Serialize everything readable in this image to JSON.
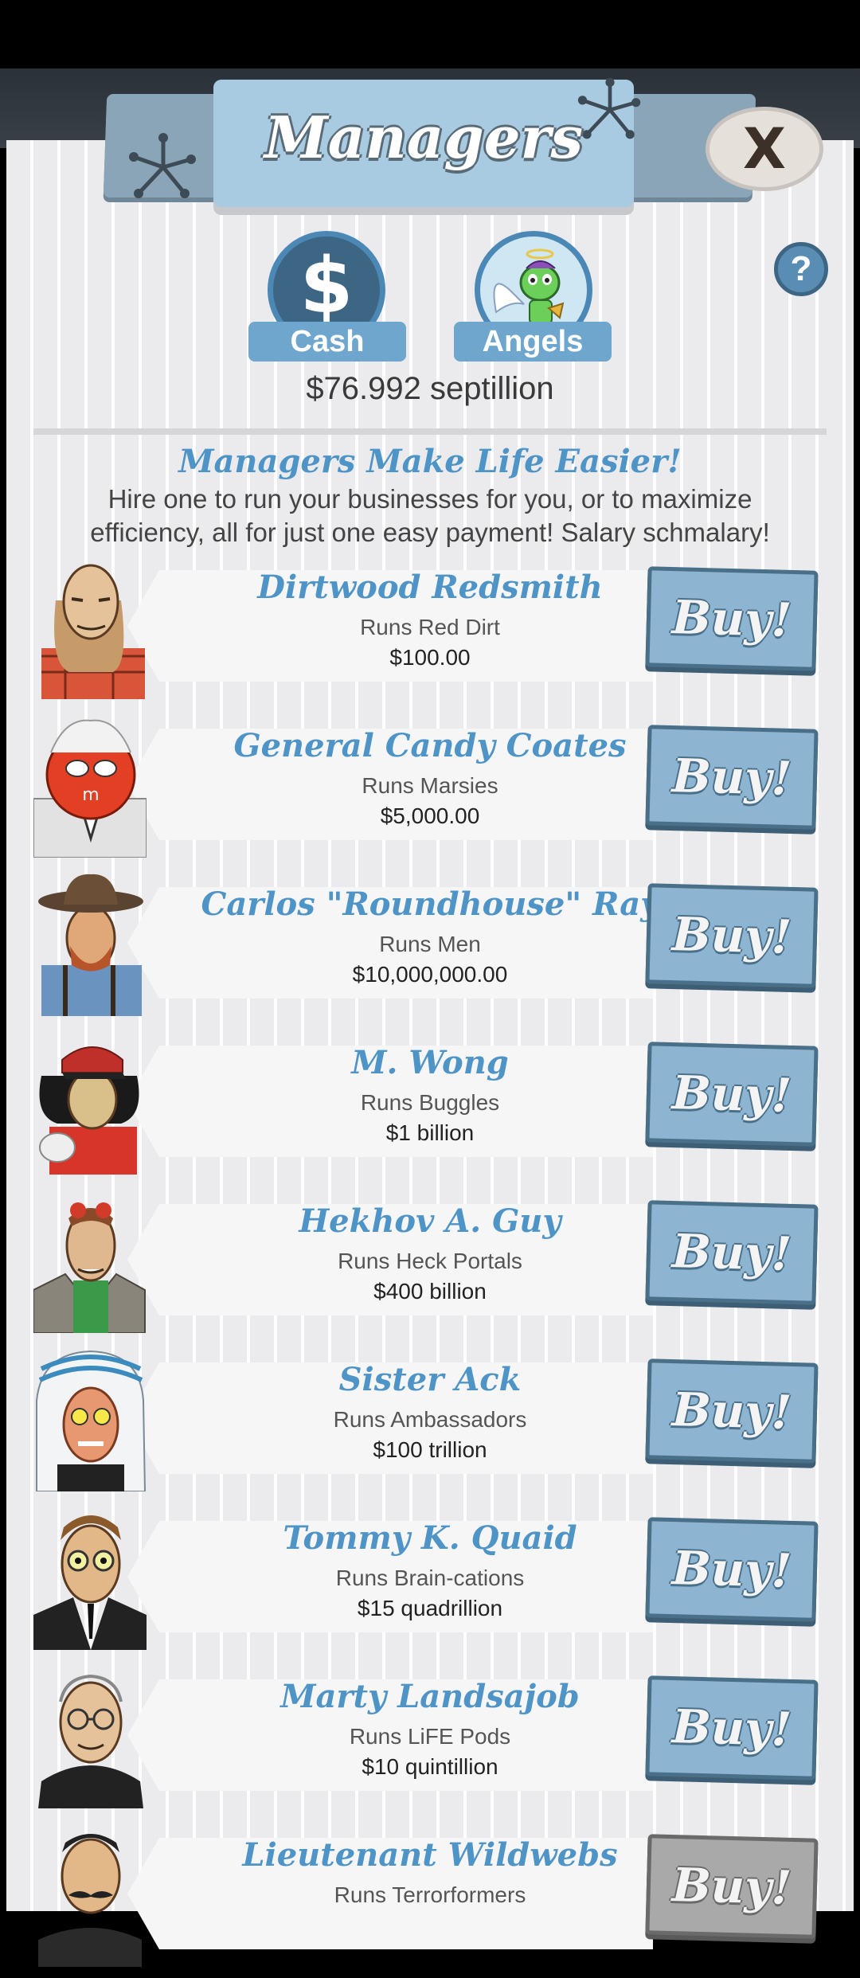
{
  "header": {
    "title": "Managers",
    "close_label": "X",
    "help_label": "?"
  },
  "currencies": [
    {
      "label": "Cash",
      "icon": "dollar-icon",
      "symbol": "$"
    },
    {
      "label": "Angels",
      "icon": "angel-icon"
    }
  ],
  "balance": "$76.992 septillion",
  "intro": {
    "title": "Managers Make Life Easier!",
    "text": "Hire one to run your businesses for you, or to maximize efficiency, all for just one easy payment! Salary schmalary!"
  },
  "buy_label": "Buy!",
  "managers": [
    {
      "name": "Dirtwood Redsmith",
      "runs": "Runs Red Dirt",
      "cost": "$100.00",
      "affordable": true
    },
    {
      "name": "General Candy Coates",
      "runs": "Runs Marsies",
      "cost": "$5,000.00",
      "affordable": true
    },
    {
      "name": "Carlos \"Roundhouse\" Ray",
      "runs": "Runs Men",
      "cost": "$10,000,000.00",
      "affordable": true
    },
    {
      "name": "M. Wong",
      "runs": "Runs Buggles",
      "cost": "$1 billion",
      "affordable": true
    },
    {
      "name": "Hekhov A. Guy",
      "runs": "Runs Heck Portals",
      "cost": "$400 billion",
      "affordable": true
    },
    {
      "name": "Sister Ack",
      "runs": "Runs Ambassadors",
      "cost": "$100 trillion",
      "affordable": true
    },
    {
      "name": "Tommy K. Quaid",
      "runs": "Runs Brain-cations",
      "cost": "$15 quadrillion",
      "affordable": true
    },
    {
      "name": "Marty Landsajob",
      "runs": "Runs LiFE Pods",
      "cost": "$10 quintillion",
      "affordable": true
    },
    {
      "name": "Lieutenant Wildwebs",
      "runs": "Runs Terrorformers",
      "cost": "",
      "affordable": false
    }
  ],
  "colors": {
    "accent": "#4f94c6",
    "buy": "#8db5d2",
    "buy_disabled": "#a9a9a9"
  }
}
